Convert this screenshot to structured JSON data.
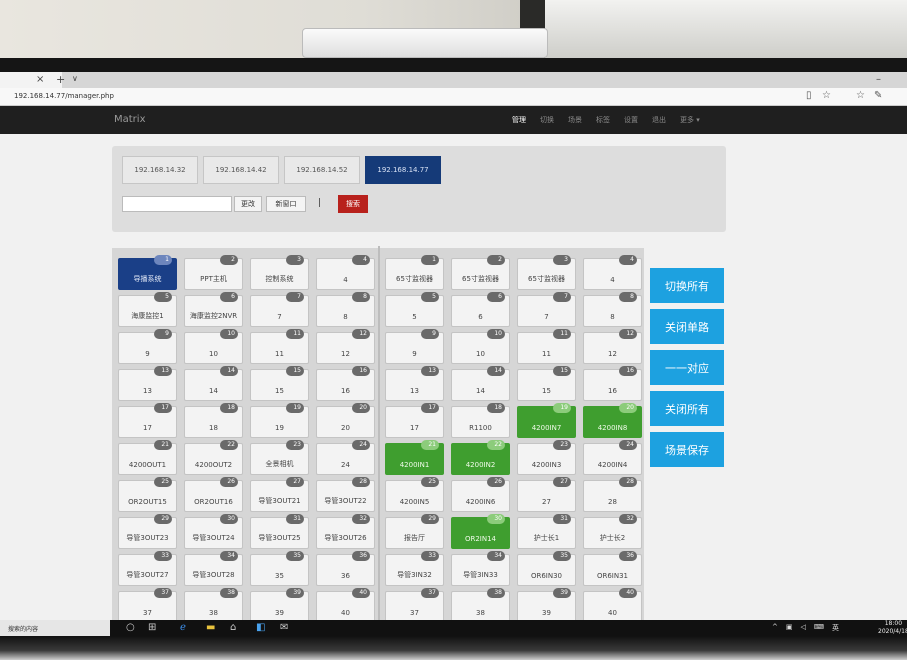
{
  "browser": {
    "url": "192.168.14.77/manager.php",
    "tab_close": "×",
    "tab_new": "+",
    "tab_menu": "∨",
    "minimize": "–"
  },
  "navbar": {
    "brand": "Matrix",
    "items": [
      {
        "label": "管理",
        "active": true
      },
      {
        "label": "切换",
        "active": false
      },
      {
        "label": "场景",
        "active": false
      },
      {
        "label": "标签",
        "active": false
      },
      {
        "label": "设置",
        "active": false
      },
      {
        "label": "退出",
        "active": false
      },
      {
        "label": "更多 ▾",
        "active": false
      }
    ]
  },
  "ip_panel": {
    "tabs": [
      "192.168.14.32",
      "192.168.14.42",
      "192.168.14.52",
      "192.168.14.77"
    ],
    "active_index": 3,
    "input_value": "",
    "modify_label": "更改",
    "new_window_label": "新窗口",
    "separator": "|",
    "search_label": "搜索"
  },
  "inputs_grid": [
    {
      "n": "1",
      "label": "导播系统",
      "state": "blue"
    },
    {
      "n": "2",
      "label": "PPT主机",
      "state": ""
    },
    {
      "n": "3",
      "label": "控制系统",
      "state": ""
    },
    {
      "n": "4",
      "label": "4",
      "state": ""
    },
    {
      "n": "5",
      "label": "海康监控1",
      "state": ""
    },
    {
      "n": "6",
      "label": "海康监控2NVR",
      "state": ""
    },
    {
      "n": "7",
      "label": "7",
      "state": ""
    },
    {
      "n": "8",
      "label": "8",
      "state": ""
    },
    {
      "n": "9",
      "label": "9",
      "state": ""
    },
    {
      "n": "10",
      "label": "10",
      "state": ""
    },
    {
      "n": "11",
      "label": "11",
      "state": ""
    },
    {
      "n": "12",
      "label": "12",
      "state": ""
    },
    {
      "n": "13",
      "label": "13",
      "state": ""
    },
    {
      "n": "14",
      "label": "14",
      "state": ""
    },
    {
      "n": "15",
      "label": "15",
      "state": ""
    },
    {
      "n": "16",
      "label": "16",
      "state": ""
    },
    {
      "n": "17",
      "label": "17",
      "state": ""
    },
    {
      "n": "18",
      "label": "18",
      "state": ""
    },
    {
      "n": "19",
      "label": "19",
      "state": ""
    },
    {
      "n": "20",
      "label": "20",
      "state": ""
    },
    {
      "n": "21",
      "label": "4200OUT1",
      "state": ""
    },
    {
      "n": "22",
      "label": "4200OUT2",
      "state": ""
    },
    {
      "n": "23",
      "label": "全景相机",
      "state": ""
    },
    {
      "n": "24",
      "label": "24",
      "state": ""
    },
    {
      "n": "25",
      "label": "OR2OUT15",
      "state": ""
    },
    {
      "n": "26",
      "label": "OR2OUT16",
      "state": ""
    },
    {
      "n": "27",
      "label": "导管3OUT21",
      "state": ""
    },
    {
      "n": "28",
      "label": "导管3OUT22",
      "state": ""
    },
    {
      "n": "29",
      "label": "导管3OUT23",
      "state": ""
    },
    {
      "n": "30",
      "label": "导管3OUT24",
      "state": ""
    },
    {
      "n": "31",
      "label": "导管3OUT25",
      "state": ""
    },
    {
      "n": "32",
      "label": "导管3OUT26",
      "state": ""
    },
    {
      "n": "33",
      "label": "导管3OUT27",
      "state": ""
    },
    {
      "n": "34",
      "label": "导管3OUT28",
      "state": ""
    },
    {
      "n": "35",
      "label": "35",
      "state": ""
    },
    {
      "n": "36",
      "label": "36",
      "state": ""
    },
    {
      "n": "37",
      "label": "37",
      "state": ""
    },
    {
      "n": "38",
      "label": "38",
      "state": ""
    },
    {
      "n": "39",
      "label": "39",
      "state": ""
    },
    {
      "n": "40",
      "label": "40",
      "state": ""
    }
  ],
  "outputs_grid": [
    {
      "n": "1",
      "label": "65寸监视器",
      "state": ""
    },
    {
      "n": "2",
      "label": "65寸监视器",
      "state": ""
    },
    {
      "n": "3",
      "label": "65寸监视器",
      "state": ""
    },
    {
      "n": "4",
      "label": "4",
      "state": ""
    },
    {
      "n": "5",
      "label": "5",
      "state": ""
    },
    {
      "n": "6",
      "label": "6",
      "state": ""
    },
    {
      "n": "7",
      "label": "7",
      "state": ""
    },
    {
      "n": "8",
      "label": "8",
      "state": ""
    },
    {
      "n": "9",
      "label": "9",
      "state": ""
    },
    {
      "n": "10",
      "label": "10",
      "state": ""
    },
    {
      "n": "11",
      "label": "11",
      "state": ""
    },
    {
      "n": "12",
      "label": "12",
      "state": ""
    },
    {
      "n": "13",
      "label": "13",
      "state": ""
    },
    {
      "n": "14",
      "label": "14",
      "state": ""
    },
    {
      "n": "15",
      "label": "15",
      "state": ""
    },
    {
      "n": "16",
      "label": "16",
      "state": ""
    },
    {
      "n": "17",
      "label": "17",
      "state": ""
    },
    {
      "n": "18",
      "label": "R1100",
      "state": ""
    },
    {
      "n": "19",
      "label": "4200IN7",
      "state": "green"
    },
    {
      "n": "20",
      "label": "4200IN8",
      "state": "green"
    },
    {
      "n": "21",
      "label": "4200IN1",
      "state": "green"
    },
    {
      "n": "22",
      "label": "4200IN2",
      "state": "green"
    },
    {
      "n": "23",
      "label": "4200IN3",
      "state": ""
    },
    {
      "n": "24",
      "label": "4200IN4",
      "state": ""
    },
    {
      "n": "25",
      "label": "4200IN5",
      "state": ""
    },
    {
      "n": "26",
      "label": "4200IN6",
      "state": ""
    },
    {
      "n": "27",
      "label": "27",
      "state": ""
    },
    {
      "n": "28",
      "label": "28",
      "state": ""
    },
    {
      "n": "29",
      "label": "报告厅",
      "state": ""
    },
    {
      "n": "30",
      "label": "OR2IN14",
      "state": "green"
    },
    {
      "n": "31",
      "label": "护士长1",
      "state": ""
    },
    {
      "n": "32",
      "label": "护士长2",
      "state": ""
    },
    {
      "n": "33",
      "label": "导管3IN32",
      "state": ""
    },
    {
      "n": "34",
      "label": "导管3IN33",
      "state": ""
    },
    {
      "n": "35",
      "label": "OR6IN30",
      "state": ""
    },
    {
      "n": "36",
      "label": "OR6IN31",
      "state": ""
    },
    {
      "n": "37",
      "label": "37",
      "state": ""
    },
    {
      "n": "38",
      "label": "38",
      "state": ""
    },
    {
      "n": "39",
      "label": "39",
      "state": ""
    },
    {
      "n": "40",
      "label": "40",
      "state": ""
    }
  ],
  "actions": [
    "切换所有",
    "关闭单路",
    "一一对应",
    "关闭所有",
    "场景保存"
  ],
  "taskbar": {
    "search_text": "搜索的内容",
    "lang": "英",
    "time": "18:00",
    "date": "2020/4/18"
  },
  "colors": {
    "selected_input": "#1a3f87",
    "active_output": "#3f9e2f",
    "action_button": "#1da1e0",
    "search_button": "#b8211c",
    "active_ip_tab": "#153a78"
  }
}
